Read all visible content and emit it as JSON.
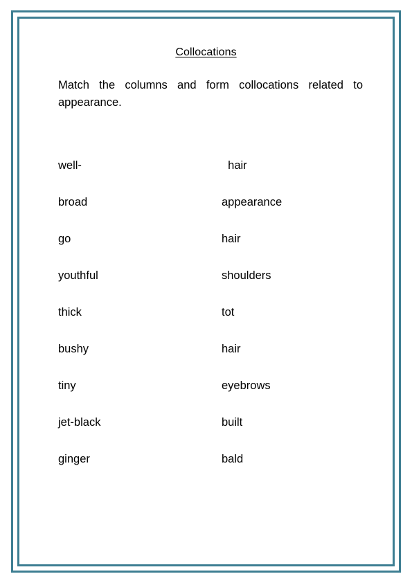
{
  "document": {
    "title": "Collocations",
    "instructions": "Match the columns and form collocations related to appearance.",
    "frame_color": "#3d7e92",
    "text_color": "#000000",
    "background_color": "#ffffff"
  },
  "exercise": {
    "rows": [
      {
        "left": "well-",
        "right": "  hair"
      },
      {
        "left": "broad",
        "right": "appearance"
      },
      {
        "left": "go",
        "right": "hair"
      },
      {
        "left": "youthful",
        "right": "shoulders"
      },
      {
        "left": "thick",
        "right": "tot"
      },
      {
        "left": "bushy",
        "right": "hair"
      },
      {
        "left": "tiny",
        "right": "eyebrows"
      },
      {
        "left": "jet-black",
        "right": "built"
      },
      {
        "left": "ginger",
        "right": "bald"
      }
    ]
  }
}
